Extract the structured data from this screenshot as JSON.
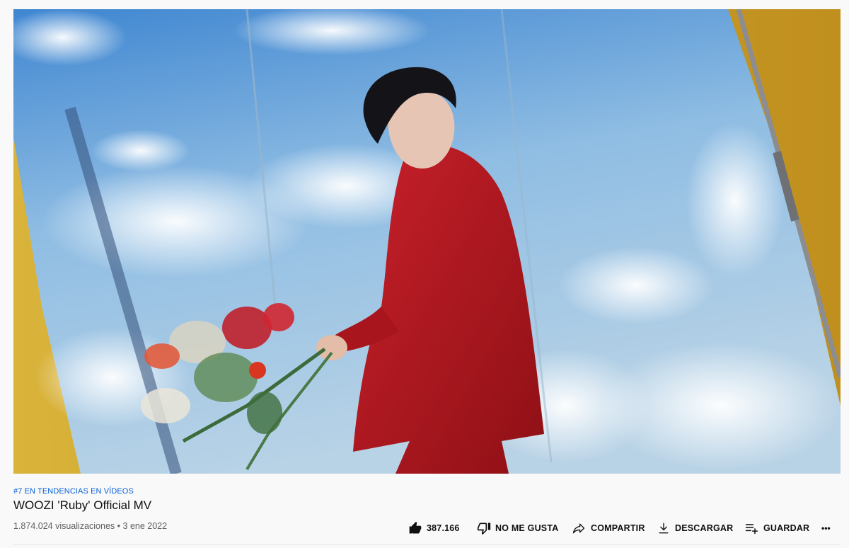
{
  "video": {
    "trend_label": "#7 EN TENDENCIAS EN VÍDEOS",
    "title": "WOOZI 'Ruby' Official MV",
    "views": "1.874.024 visualizaciones",
    "separator": "•",
    "date": "3 ene 2022"
  },
  "actions": {
    "like_count": "387.166",
    "dislike_label": "NO ME GUSTA",
    "share_label": "COMPARTIR",
    "download_label": "DESCARGAR",
    "save_label": "GUARDAR",
    "more_label": "•••"
  },
  "icons": {
    "like": "thumb-up-filled-icon",
    "dislike": "thumb-down-icon",
    "share": "share-arrow-icon",
    "download": "download-icon",
    "save": "playlist-add-icon",
    "more": "more-horizontal-icon"
  },
  "colors": {
    "trend_link": "#065fd4",
    "backdrop_yellow": "#c9a230",
    "sky_blue": "#5d9bd4",
    "suit_red": "#b31a1f"
  }
}
